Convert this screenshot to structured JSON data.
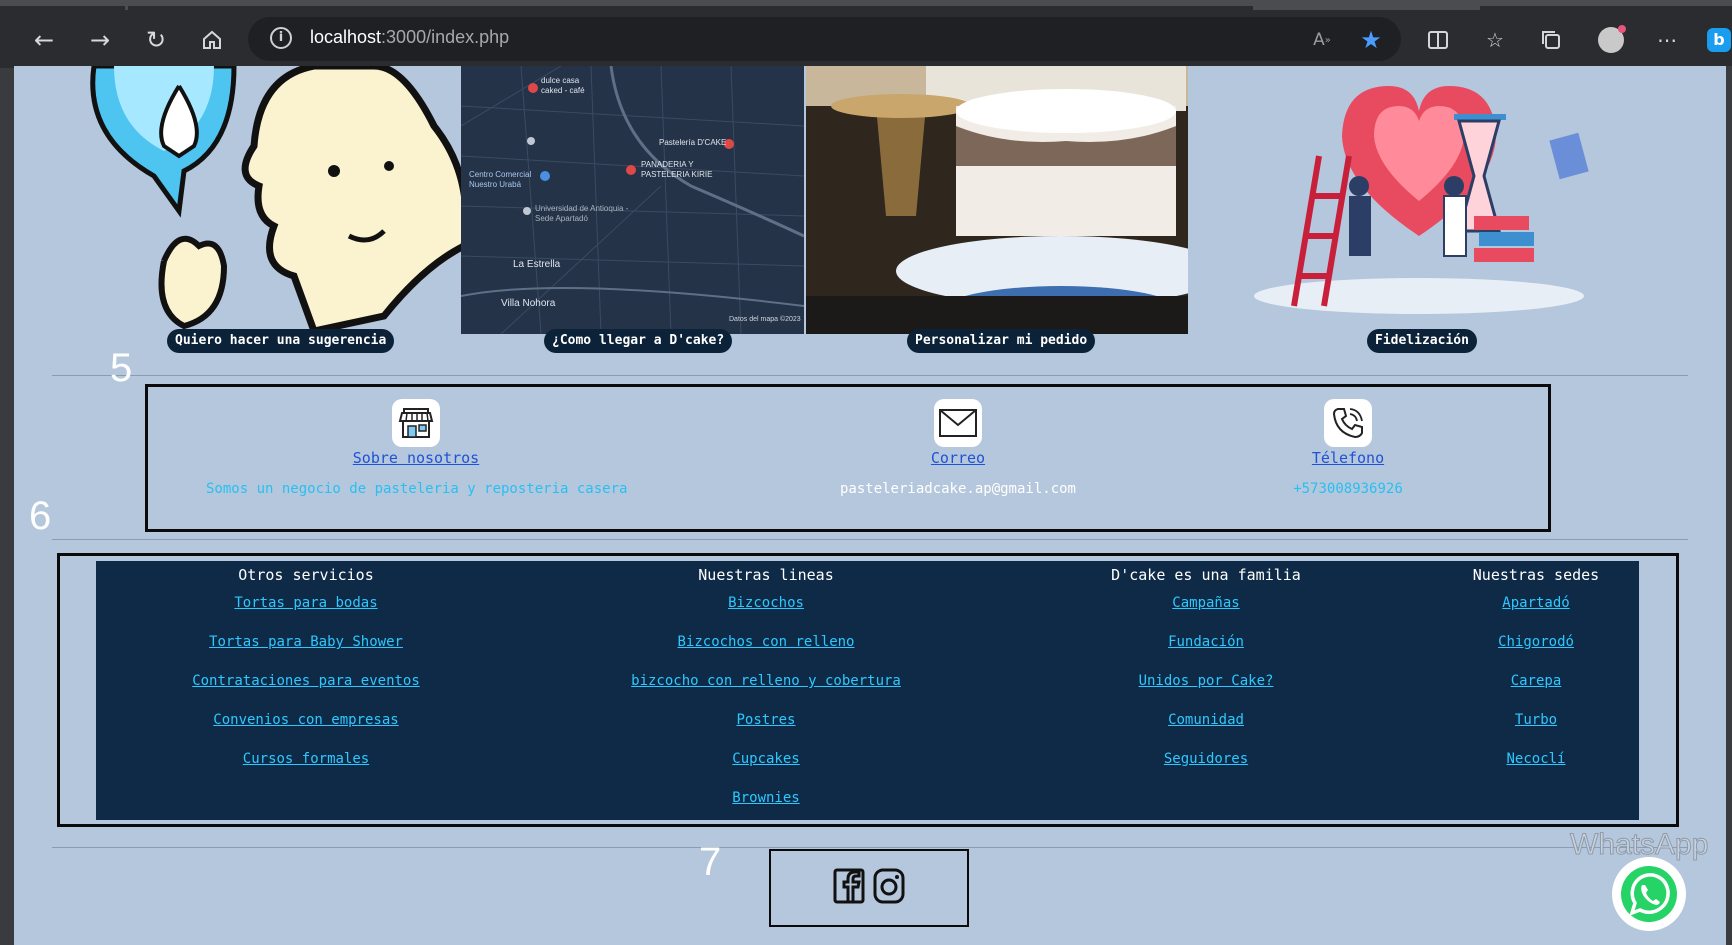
{
  "browser": {
    "url_host": "localhost",
    "url_path": ":3000/index.php"
  },
  "cards": [
    {
      "caption": "Quiero hacer una sugerencia"
    },
    {
      "caption": "¿Como llegar a D'cake?"
    },
    {
      "caption": "Personalizar mi pedido"
    },
    {
      "caption": "Fidelización"
    }
  ],
  "map_labels": {
    "a": "dulce casa caked - café",
    "b": "Pastelería D'CAKE",
    "c": "PANADERIA Y PASTELERIA KIRIE",
    "d": "Centro Comercial Nuestro Urabá",
    "e": "Universidad de Antioquia - Sede Apartadó",
    "f": "La Estrella",
    "g": "Villa Nohora",
    "h": "Datos del mapa ©2023"
  },
  "annotations": {
    "n5": "5",
    "n6": "6",
    "n7": "7"
  },
  "contact": {
    "about": {
      "label": "Sobre nosotros",
      "desc": "Somos un negocio de pasteleria y reposteria casera"
    },
    "email": {
      "label": "Correo",
      "desc": "pasteleriadcake.ap@gmail.com"
    },
    "phone": {
      "label": "Télefono",
      "desc": "+573008936926"
    }
  },
  "footer": {
    "columns": [
      {
        "title": "Otros servicios",
        "items": [
          "Tortas para bodas",
          "Tortas para Baby Shower",
          "Contrataciones para eventos",
          "Convenios con empresas",
          "Cursos formales"
        ]
      },
      {
        "title": "Nuestras lineas",
        "items": [
          "Bizcochos",
          "Bizcochos con relleno",
          "bizcocho con relleno y cobertura",
          "Postres",
          "Cupcakes",
          "Brownies"
        ]
      },
      {
        "title": "D'cake es una familia",
        "items": [
          "Campañas",
          "Fundación",
          "Unidos por Cake?",
          "Comunidad",
          "Seguidores"
        ]
      },
      {
        "title": "Nuestras sedes",
        "items": [
          "Apartadó",
          "Chigorodó",
          "Carepa",
          "Turbo",
          "Necoclí"
        ]
      }
    ]
  },
  "whatsapp": {
    "label": "WhatsApp"
  }
}
